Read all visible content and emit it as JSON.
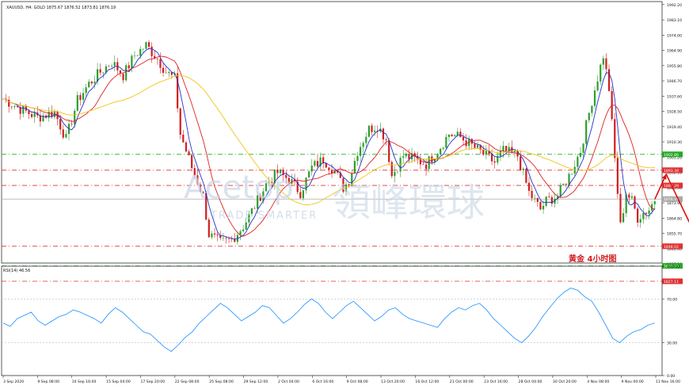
{
  "header": {
    "symbol_text": "XAUUSD, H4:  GOLD  1875.67 1876.52 1873.81 1876.19"
  },
  "watermark": {
    "brand": "Acetop",
    "tagline": "TRADE SMARTER",
    "chinese": "領峰環球"
  },
  "caption": "黄金   4小时图",
  "rsi_label": "RSI(14) 46.56",
  "colors": {
    "bull": "#2e9e2e",
    "bear": "#d11f1f",
    "ma_fast": "#2233cc",
    "ma_mid": "#dd2222",
    "ma_slow": "#f0c419",
    "rsi": "#1e90ff",
    "arrow": "#e01010",
    "red_level": "#e03030",
    "green_level": "#22aa22"
  },
  "chart_data": [
    {
      "type": "candlestick",
      "ylim": [
        1838,
        1994
      ],
      "y_ticks": [
        "1992.20",
        "1983.10",
        "1974.00",
        "1964.90",
        "1955.80",
        "1946.70",
        "1937.60",
        "1928.50",
        "1919.40",
        "1910.30",
        "1901.20",
        "1892.10",
        "1883.00",
        "1873.90",
        "1864.80",
        "1855.70",
        "1846.60",
        "1837.50"
      ],
      "x_ticks": [
        "3 Sep 2020",
        "9 Sep 08:00",
        "10 Sep 16:00",
        "15 Sep 04:00",
        "17 Sep 20:00",
        "22 Sep 08:00",
        "25 Sep 08:00",
        "29 Sep 12:00",
        "2 Oct 04:00",
        "6 Oct 16:00",
        "9 Oct 08:00",
        "13 Oct 20:00",
        "16 Oct 12:00",
        "21 Oct 00:00",
        "23 Oct 16:00",
        "28 Oct 04:00",
        "30 Oct 20:00",
        "4 Nov 08:00",
        "9 Nov 00:00",
        "11 Nov 16:00"
      ],
      "levels": [
        {
          "value": 1902.86,
          "label": "1902.86",
          "color": "green"
        },
        {
          "value": 1893.39,
          "label": "1893.39",
          "color": "red"
        },
        {
          "value": 1884.29,
          "label": "1884.29",
          "color": "red"
        },
        {
          "value": 1876.19,
          "label": "1876.19",
          "color": "grey"
        },
        {
          "value": 1848.02,
          "label": "1848.02",
          "color": "red"
        },
        {
          "value": 1836.3,
          "label": "1836.30",
          "color": "green"
        },
        {
          "value": 1827.11,
          "label": "1827.11",
          "color": "red"
        }
      ],
      "price_path": [
        [
          0,
          1936
        ],
        [
          6,
          1930
        ],
        [
          12,
          1925
        ],
        [
          18,
          1928
        ],
        [
          22,
          1912
        ],
        [
          26,
          1935
        ],
        [
          30,
          1945
        ],
        [
          34,
          1952
        ],
        [
          38,
          1958
        ],
        [
          42,
          1950
        ],
        [
          46,
          1962
        ],
        [
          50,
          1968
        ],
        [
          54,
          1960
        ],
        [
          57,
          1952
        ],
        [
          60,
          1948
        ],
        [
          62,
          1915
        ],
        [
          66,
          1895
        ],
        [
          70,
          1878
        ],
        [
          72,
          1855
        ],
        [
          76,
          1850
        ],
        [
          80,
          1852
        ],
        [
          84,
          1860
        ],
        [
          88,
          1872
        ],
        [
          92,
          1885
        ],
        [
          96,
          1892
        ],
        [
          100,
          1888
        ],
        [
          104,
          1880
        ],
        [
          108,
          1895
        ],
        [
          112,
          1900
        ],
        [
          116,
          1893
        ],
        [
          119,
          1883
        ],
        [
          121,
          1887
        ],
        [
          124,
          1905
        ],
        [
          128,
          1918
        ],
        [
          131,
          1920
        ],
        [
          134,
          1912
        ],
        [
          136,
          1890
        ],
        [
          140,
          1902
        ],
        [
          144,
          1900
        ],
        [
          148,
          1897
        ],
        [
          152,
          1905
        ],
        [
          156,
          1915
        ],
        [
          160,
          1913
        ],
        [
          164,
          1908
        ],
        [
          168,
          1903
        ],
        [
          172,
          1898
        ],
        [
          175,
          1905
        ],
        [
          180,
          1902
        ],
        [
          184,
          1880
        ],
        [
          188,
          1870
        ],
        [
          190,
          1875
        ],
        [
          194,
          1878
        ],
        [
          198,
          1890
        ],
        [
          202,
          1905
        ],
        [
          206,
          1935
        ],
        [
          210,
          1962
        ],
        [
          212,
          1942
        ],
        [
          214,
          1900
        ],
        [
          216,
          1860
        ],
        [
          218,
          1880
        ],
        [
          220,
          1875
        ],
        [
          222,
          1865
        ],
        [
          224,
          1868
        ],
        [
          226,
          1870
        ],
        [
          228,
          1876
        ]
      ],
      "arrow_path": [
        [
          228,
          1876
        ],
        [
          232,
          1891
        ],
        [
          245,
          1845
        ]
      ]
    },
    {
      "type": "line",
      "title": "RSI(14) 46.56",
      "ylim": [
        0,
        100
      ],
      "y_ticks": [
        "100.00",
        "70.00",
        "30.00",
        "0.00"
      ],
      "values": [
        48,
        45,
        52,
        55,
        58,
        50,
        46,
        50,
        54,
        56,
        60,
        58,
        55,
        52,
        48,
        56,
        62,
        58,
        52,
        46,
        40,
        38,
        32,
        26,
        22,
        28,
        35,
        40,
        48,
        54,
        60,
        66,
        62,
        56,
        50,
        54,
        58,
        64,
        62,
        55,
        48,
        52,
        58,
        65,
        70,
        66,
        58,
        52,
        58,
        64,
        68,
        62,
        56,
        50,
        54,
        60,
        62,
        56,
        52,
        50,
        48,
        46,
        44,
        52,
        58,
        62,
        60,
        64,
        66,
        60,
        52,
        46,
        40,
        34,
        30,
        36,
        44,
        54,
        62,
        70,
        76,
        80,
        78,
        72,
        68,
        58,
        46,
        34,
        30,
        36,
        40,
        42,
        46,
        48
      ]
    }
  ]
}
